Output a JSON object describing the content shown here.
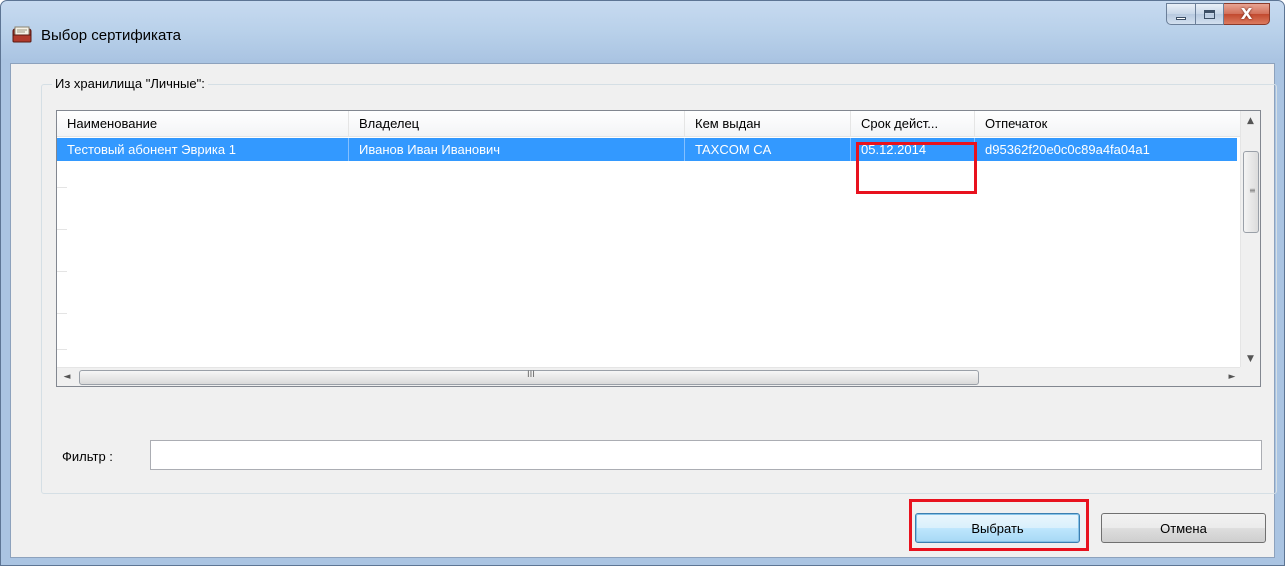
{
  "window": {
    "title": "Выбор сертификата",
    "icon": "certificate-app-icon"
  },
  "caption_buttons": {
    "minimize_icon": "minimize-icon",
    "maximize_icon": "maximize-icon",
    "close_glyph": "X"
  },
  "group": {
    "label": "Из хранилища \"Личные\":"
  },
  "table": {
    "columns": [
      "Наименование",
      "Владелец",
      "Кем выдан",
      "Срок дейст...",
      "Отпечаток"
    ],
    "rows": [
      {
        "name": "Тестовый абонент Эврика 1",
        "owner": "Иванов Иван Иванович",
        "issuer": "TAXCOM CA",
        "valid_to": "05.12.2014",
        "thumbprint": "d95362f20e0c0c89a4fa04a1"
      }
    ],
    "selected_row": 0
  },
  "scrollbar": {
    "up_arrow": "▲",
    "down_arrow": "▼",
    "left_arrow": "◄",
    "right_arrow": "►",
    "h_grip": "III",
    "v_grip": "≡"
  },
  "filter": {
    "label": "Фильтр :",
    "value": ""
  },
  "buttons": {
    "ok": "Выбрать",
    "cancel": "Отмена"
  },
  "colors": {
    "selection": "#3399ff",
    "highlight": "#e8121e"
  }
}
